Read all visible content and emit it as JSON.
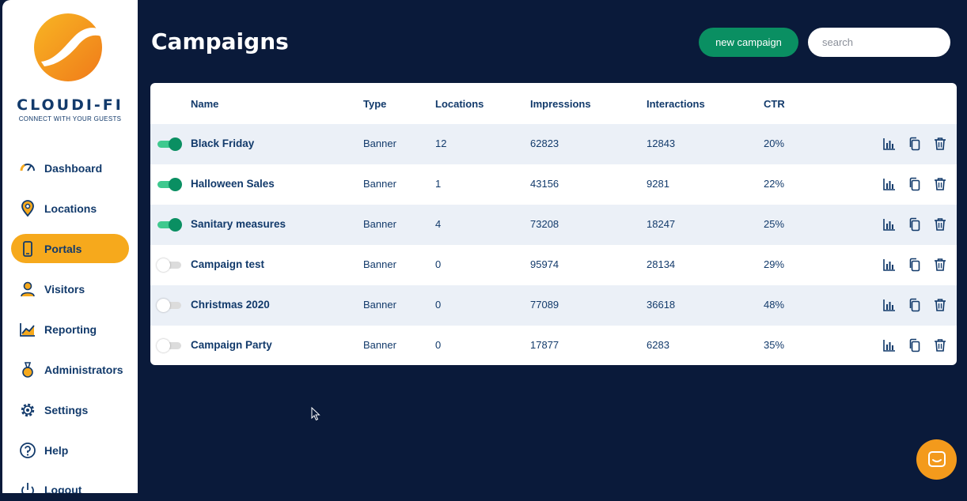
{
  "brand": {
    "name": "CLOUDI-FI",
    "tagline": "CONNECT WITH YOUR GUESTS",
    "logo_colors": [
      "#f6a91c",
      "#f07b1a"
    ]
  },
  "sidebar": {
    "items": [
      {
        "label": "Dashboard",
        "icon": "gauge-icon",
        "active": false
      },
      {
        "label": "Locations",
        "icon": "location-pin-icon",
        "active": false
      },
      {
        "label": "Portals",
        "icon": "phone-icon",
        "active": true
      },
      {
        "label": "Visitors",
        "icon": "user-icon",
        "active": false
      },
      {
        "label": "Reporting",
        "icon": "line-chart-icon",
        "active": false
      },
      {
        "label": "Administrators",
        "icon": "admin-icon",
        "active": false
      },
      {
        "label": "Settings",
        "icon": "gear-icon",
        "active": false
      },
      {
        "label": "Help",
        "icon": "help-icon",
        "active": false
      },
      {
        "label": "Logout",
        "icon": "power-icon",
        "active": false
      }
    ]
  },
  "header": {
    "title": "Campaigns",
    "new_campaign_label": "new campaign",
    "search_placeholder": "search"
  },
  "table": {
    "columns": [
      "Name",
      "Type",
      "Locations",
      "Impressions",
      "Interactions",
      "CTR"
    ],
    "rows": [
      {
        "enabled": true,
        "name": "Black Friday",
        "type": "Banner",
        "locations": "12",
        "impressions": "62823",
        "interactions": "12843",
        "ctr": "20%"
      },
      {
        "enabled": true,
        "name": "Halloween Sales",
        "type": "Banner",
        "locations": "1",
        "impressions": "43156",
        "interactions": "9281",
        "ctr": "22%"
      },
      {
        "enabled": true,
        "name": "Sanitary measures",
        "type": "Banner",
        "locations": "4",
        "impressions": "73208",
        "interactions": "18247",
        "ctr": "25%"
      },
      {
        "enabled": false,
        "name": "Campaign test",
        "type": "Banner",
        "locations": "0",
        "impressions": "95974",
        "interactions": "28134",
        "ctr": "29%"
      },
      {
        "enabled": false,
        "name": "Christmas 2020",
        "type": "Banner",
        "locations": "0",
        "impressions": "77089",
        "interactions": "36618",
        "ctr": "48%"
      },
      {
        "enabled": false,
        "name": "Campaign Party",
        "type": "Banner",
        "locations": "0",
        "impressions": "17877",
        "interactions": "6283",
        "ctr": "35%"
      }
    ],
    "row_actions": [
      "bar-chart-icon",
      "copy-icon",
      "trash-icon"
    ]
  },
  "colors": {
    "background": "#0a1a3a",
    "accent_green": "#0a8f62",
    "accent_orange": "#f6a91c",
    "text_navy": "#123a6b"
  },
  "chat": {
    "icon": "chat-icon"
  }
}
